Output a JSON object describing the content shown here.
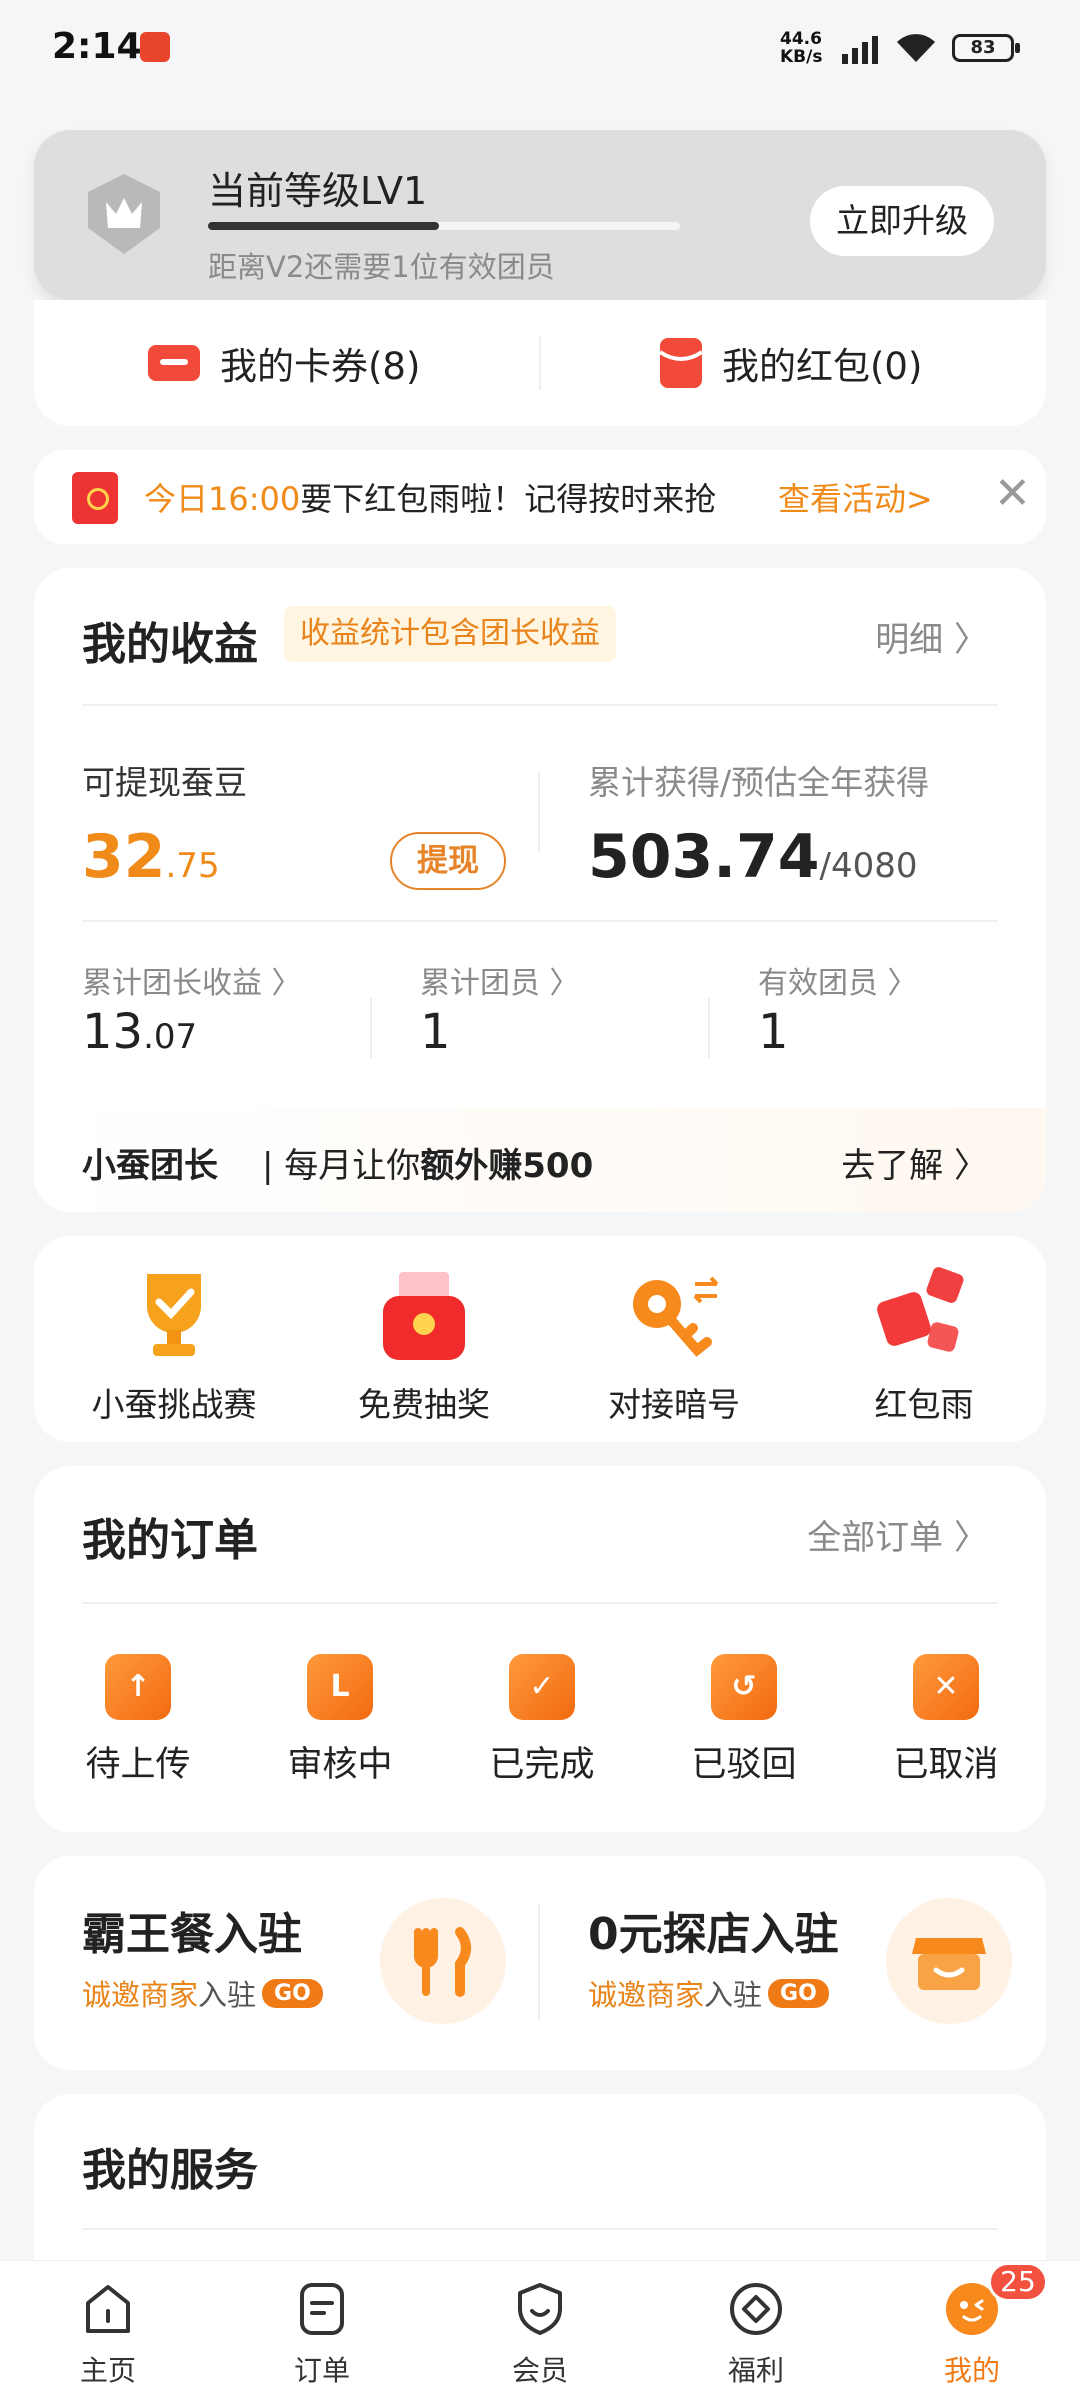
{
  "status_bar": {
    "time": "2:14",
    "net_speed_value": "44.6",
    "net_speed_unit": "KB/s",
    "battery": "83"
  },
  "level": {
    "title": "当前等级LV1",
    "progress": 0.49,
    "hint": "距离V2还需要1位有效团员",
    "upgrade_label": "立即升级"
  },
  "coupons": {
    "cards_label": "我的卡券(8)",
    "redpack_label": "我的红包(0)"
  },
  "notice": {
    "time": "今日16:00",
    "message": "要下红包雨啦！记得按时来抢",
    "link": "查看活动>",
    "close": "✕"
  },
  "earnings": {
    "title": "我的收益",
    "tag": "收益统计包含团长收益",
    "detail_label": "明细 〉",
    "withdrawable_label": "可提现蚕豆",
    "withdrawable_int": "32",
    "withdrawable_dec": ".75",
    "withdraw_button": "提现",
    "total_label": "累计获得/预估全年获得",
    "total_value": "503.74",
    "total_estimate": "/4080",
    "leader_income_label": "累计团长收益 〉",
    "leader_income_int": "13",
    "leader_income_dec": ".07",
    "members_label": "累计团员 〉",
    "members_value": "1",
    "valid_members_label": "有效团员 〉",
    "valid_members_value": "1",
    "promo_brand": "小蚕团长",
    "promo_text_a": "每月让你",
    "promo_text_b": "额外赚500",
    "promo_link": "去了解 〉"
  },
  "features": [
    {
      "label": "小蚕挑战赛",
      "icon": "trophy-icon"
    },
    {
      "label": "免费抽奖",
      "icon": "lottery-icon"
    },
    {
      "label": "对接暗号",
      "icon": "key-icon"
    },
    {
      "label": "红包雨",
      "icon": "redpacket-rain-icon"
    }
  ],
  "orders": {
    "title": "我的订单",
    "all_label": "全部订单 〉",
    "items": [
      {
        "label": "待上传",
        "glyph": "↑"
      },
      {
        "label": "审核中",
        "glyph": "L"
      },
      {
        "label": "已完成",
        "glyph": "✓"
      },
      {
        "label": "已驳回",
        "glyph": "↺"
      },
      {
        "label": "已取消",
        "glyph": "✕"
      }
    ]
  },
  "merchant": {
    "left_title": "霸王餐入驻",
    "right_title": "0元探店入驻",
    "sub_a": "诚邀商家",
    "sub_b": "入驻",
    "go": "GO"
  },
  "services": {
    "title": "我的服务"
  },
  "nav": {
    "items": [
      {
        "label": "主页"
      },
      {
        "label": "订单"
      },
      {
        "label": "会员"
      },
      {
        "label": "福利"
      },
      {
        "label": "我的"
      }
    ],
    "badge": "25"
  },
  "colors": {
    "accent": "#f08a19",
    "badge_red": "#f25140"
  }
}
